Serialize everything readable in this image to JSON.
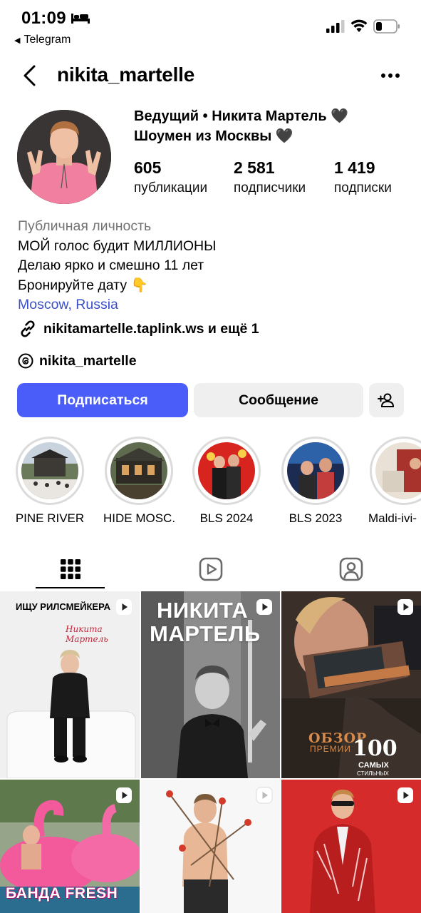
{
  "status_bar": {
    "time": "01:09",
    "back_app": "Telegram"
  },
  "header": {
    "username": "nikita_martelle"
  },
  "profile": {
    "name_line1": "Ведущий • Никита Мартель 🖤",
    "name_line2": "Шоумен из Москвы 🖤",
    "stats": [
      {
        "value": "605",
        "label": "публикации"
      },
      {
        "value": "2 581",
        "label": "подписчики"
      },
      {
        "value": "1 419",
        "label": "подписки"
      }
    ],
    "category": "Публичная личность",
    "bio_lines": [
      "МОЙ голос будит МИЛЛИОНЫ",
      "Делаю ярко и смешно 11 лет",
      "Бронируйте дату 👇"
    ],
    "location": "Moscow, Russia",
    "link": "nikitamartelle.taplink.ws и ещё 1",
    "threads": "nikita_martelle"
  },
  "buttons": {
    "follow": "Подписаться",
    "message": "Сообщение"
  },
  "highlights": [
    {
      "label": "PINE RIVER"
    },
    {
      "label": "HIDE MOSC..."
    },
    {
      "label": "BLS 2024"
    },
    {
      "label": "BLS 2023"
    },
    {
      "label": "Maldi-ivi-"
    }
  ],
  "tabs": [
    {
      "icon": "grid-icon",
      "active": true
    },
    {
      "icon": "reels-icon",
      "active": false
    },
    {
      "icon": "tagged-icon",
      "active": false
    }
  ],
  "posts": [
    {
      "caption": "ИЩУ РИЛСМЕЙКЕРА",
      "signature": "Никита Мартель"
    },
    {
      "caption_line1": "НИКИТА",
      "caption_line2": "МАРТЕЛЬ"
    },
    {
      "caption_line1": "ОБЗОР",
      "caption_line2": "ПРЕМИИ",
      "badge": "100",
      "badge_sub": "САМЫХ",
      "badge_sub2": "СТИЛЬНЫХ"
    },
    {
      "caption": "БАНДА FRESH"
    },
    {},
    {}
  ],
  "colors": {
    "follow_button": "#4a5df9",
    "secondary_button": "#efefef",
    "location_link": "#3b4fc9",
    "category_text": "#737373"
  }
}
